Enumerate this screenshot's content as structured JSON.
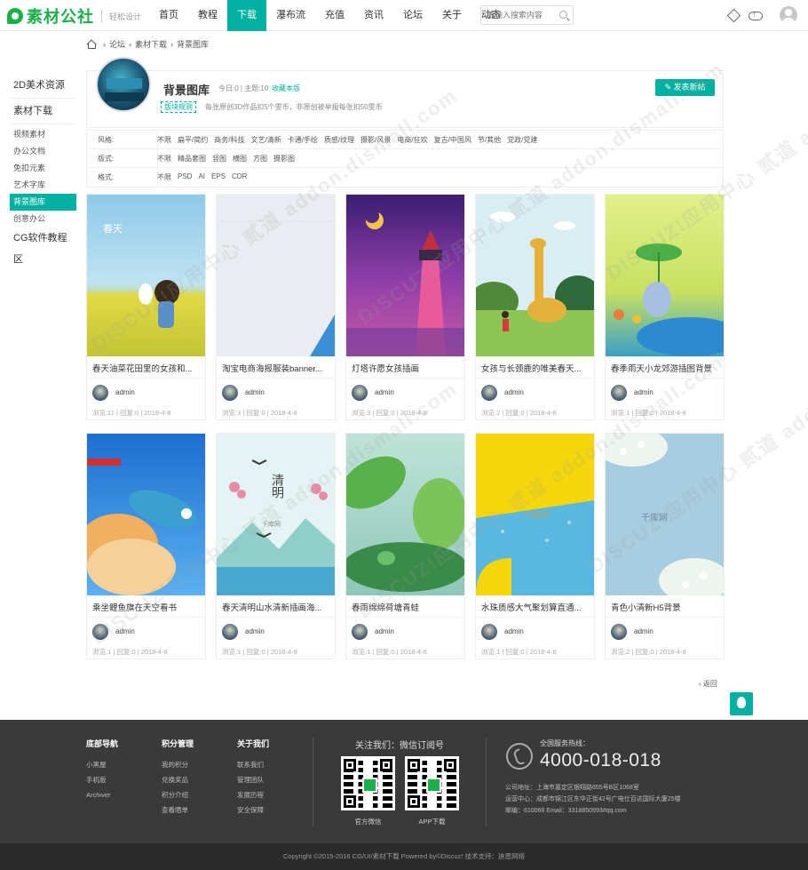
{
  "header": {
    "logo_text": "素材公社",
    "slogan": "轻松设计",
    "nav": [
      "首页",
      "教程",
      "下载",
      "瀑布流",
      "充值",
      "资讯",
      "论坛",
      "关于",
      "动态"
    ],
    "search_placeholder": "请输入搜索内容"
  },
  "breadcrumb": [
    "论坛",
    "素材下载",
    "背景图库"
  ],
  "sidebar": [
    {
      "label": "2D美术资源",
      "big": true
    },
    {
      "label": "素材下载",
      "big": true
    },
    {
      "label": "视频素材"
    },
    {
      "label": "办公文档"
    },
    {
      "label": "免扣元素"
    },
    {
      "label": "艺术字库"
    },
    {
      "label": "背景图库",
      "active": true
    },
    {
      "label": "创意办公"
    },
    {
      "label": "CG软件教程区",
      "big": true
    }
  ],
  "forum": {
    "title": "背景图库",
    "stats": "今日:0 | 主题:10",
    "favorite": "收藏本版",
    "rule_label": "版块规则",
    "rule": "每张原创3D作品扣5个雯币，非原创被举报每张扣50雯币",
    "post_button": "发表新帖"
  },
  "filters": [
    {
      "label": "风格:",
      "options": [
        "不限",
        "扁平/简约",
        "商务/科技",
        "文艺/清新",
        "卡通/手绘",
        "质感/纹理",
        "摄影/风景",
        "电商/狂欢",
        "复古/中国风",
        "节/其他",
        "党政/党建"
      ]
    },
    {
      "label": "版式:",
      "options": [
        "不限",
        "精品套图",
        "竖图",
        "横图",
        "方图",
        "摄影图"
      ]
    },
    {
      "label": "格式:",
      "options": [
        "不限",
        "PSD",
        "AI",
        "EPS",
        "CDR"
      ]
    }
  ],
  "posts": [
    {
      "title": "春天油菜花田里的女孩和...",
      "author": "admin",
      "meta": "浏览:11  |  回复:0  |  2018-4-8"
    },
    {
      "title": "淘宝电商海报服装banner...",
      "author": "admin",
      "meta": "浏览:3  |  回复:0  |  2018-4-8"
    },
    {
      "title": "灯塔许愿女孩插画",
      "author": "admin",
      "meta": "浏览:3  |  回复:0  |  2018-4-8"
    },
    {
      "title": "女孩与长颈鹿的唯美春天...",
      "author": "admin",
      "meta": "浏览:2  |  回复:0  |  2018-4-8"
    },
    {
      "title": "春季雨天小龙郊游插图背景",
      "author": "admin",
      "meta": "浏览:1  |  回复:0  |  2018-4-8"
    },
    {
      "title": "乘坐鲤鱼旗在天空看书",
      "author": "admin",
      "meta": "浏览:1  |  回复:0  |  2018-4-8"
    },
    {
      "title": "春天清明山水清新插画海...",
      "author": "admin",
      "meta": "浏览:1  |  回复:0  |  2018-4-8"
    },
    {
      "title": "春雨绵绵荷塘青蛙",
      "author": "admin",
      "meta": "浏览:1  |  回复:0  |  2018-4-8"
    },
    {
      "title": "水珠质感大气聚划算直通...",
      "author": "admin",
      "meta": "浏览:1  |  回复:0  |  2018-4-8"
    },
    {
      "title": "青色小清新H5背景",
      "author": "admin",
      "meta": "浏览:2  |  回复:0  |  2018-4-8"
    }
  ],
  "image_texts": {
    "spring": "春天",
    "qingming": "清明",
    "qianku": "千库网"
  },
  "pager_back": "返回",
  "footer": {
    "col1": {
      "title": "底部导航",
      "links": [
        "小黑屋",
        "手机版",
        "Archiver"
      ]
    },
    "col2": {
      "title": "积分管理",
      "links": [
        "我的积分",
        "兑换奖品",
        "积分介绍",
        "查看晒单"
      ]
    },
    "col3": {
      "title": "关于我们",
      "links": [
        "联系我们",
        "管理团队",
        "发展历程",
        "安全保障"
      ]
    },
    "follow": "关注我们：微信订阅号",
    "qr1_label": "官方微信",
    "qr2_label": "APP下载",
    "hotline_label": "全国服务热线：",
    "hotline": "4000-018-018",
    "address1": "公司地址：上海市嘉定区银翔路655号B区1068室",
    "address2": "运营中心：成都市锦江区东华正街42号广电仕百达国际大厦25楼",
    "address3": "邮编：610066 Email：3318850993#qq.com"
  },
  "copyright": "Copyright ©2015-2016 CG/UI/素材下载 Powered by©Discuz! 技术支持：迪恩网络",
  "watermark": "DISCUZ!应用中心 贰道 addon.dismall.com"
}
